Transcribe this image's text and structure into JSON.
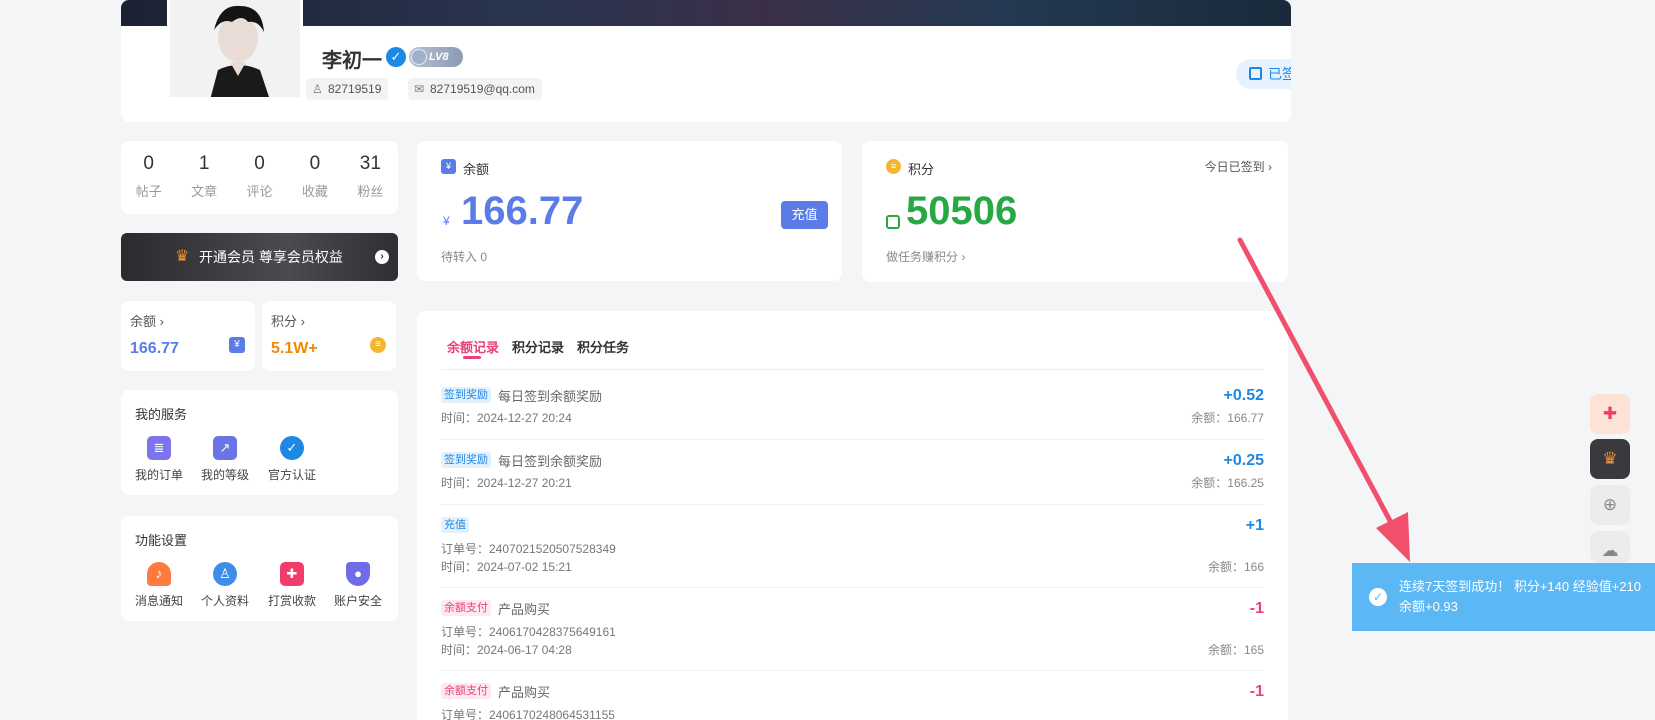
{
  "profile": {
    "username": "李初一",
    "level": "LV8",
    "user_id": "82719519",
    "email": "82719519@qq.com",
    "signed_label": "已签到"
  },
  "stats": [
    {
      "num": "0",
      "label": "帖子"
    },
    {
      "num": "1",
      "label": "文章"
    },
    {
      "num": "0",
      "label": "评论"
    },
    {
      "num": "0",
      "label": "收藏"
    },
    {
      "num": "31",
      "label": "粉丝"
    }
  ],
  "vip": {
    "label": "开通会员 尊享会员权益"
  },
  "mini": {
    "balance_title": "余额 ›",
    "balance_value": "166.77",
    "points_title": "积分 ›",
    "points_value": "5.1W+"
  },
  "services": {
    "title": "我的服务",
    "items": [
      {
        "label": "我的订单",
        "icon": "order-icon"
      },
      {
        "label": "我的等级",
        "icon": "level-icon"
      },
      {
        "label": "官方认证",
        "icon": "verified-icon"
      }
    ]
  },
  "settings": {
    "title": "功能设置",
    "items": [
      {
        "label": "消息通知",
        "icon": "bell-icon"
      },
      {
        "label": "个人资料",
        "icon": "profile-icon"
      },
      {
        "label": "打赏收款",
        "icon": "gift-icon"
      },
      {
        "label": "账户安全",
        "icon": "shield-icon"
      }
    ]
  },
  "balance": {
    "title": "余额",
    "currency": "¥",
    "value": "166.77",
    "recharge": "充值",
    "pending": "待转入 0"
  },
  "points": {
    "title": "积分",
    "signed_today": "今日已签到 ›",
    "value": "50506",
    "task": "做任务赚积分 ›"
  },
  "records": {
    "tabs": [
      "余额记录",
      "积分记录",
      "积分任务"
    ],
    "items": [
      {
        "tag": "签到奖励",
        "desc": "每日签到余额奖励",
        "order": "",
        "time": "时间：2024-12-27 20:24",
        "amount": "+0.52",
        "after": "余额：166.77"
      },
      {
        "tag": "签到奖励",
        "desc": "每日签到余额奖励",
        "order": "",
        "time": "时间：2024-12-27 20:21",
        "amount": "+0.25",
        "after": "余额：166.25"
      },
      {
        "tag": "充值",
        "desc": "",
        "order": "订单号：2407021520507528349",
        "time": "时间：2024-07-02 15:21",
        "amount": "+1",
        "after": "余额：166"
      },
      {
        "tag": "余额支付",
        "desc": "产品购买",
        "order": "订单号：2406170428375649161",
        "time": "时间：2024-06-17 04:28",
        "amount": "-1",
        "after": "余额：165"
      },
      {
        "tag": "余额支付",
        "desc": "产品购买",
        "order": "订单号：2406170248064531155",
        "time": "",
        "amount": "-1",
        "after": ""
      }
    ]
  },
  "toast": {
    "message": "连续7天签到成功！ 积分+140 经验值+210 余额+0.93"
  },
  "colors": {
    "accent_blue": "#5b7ce6",
    "points_green": "#27a845",
    "tab_active": "#e8427a",
    "toast_bg": "#5bb8f5"
  }
}
